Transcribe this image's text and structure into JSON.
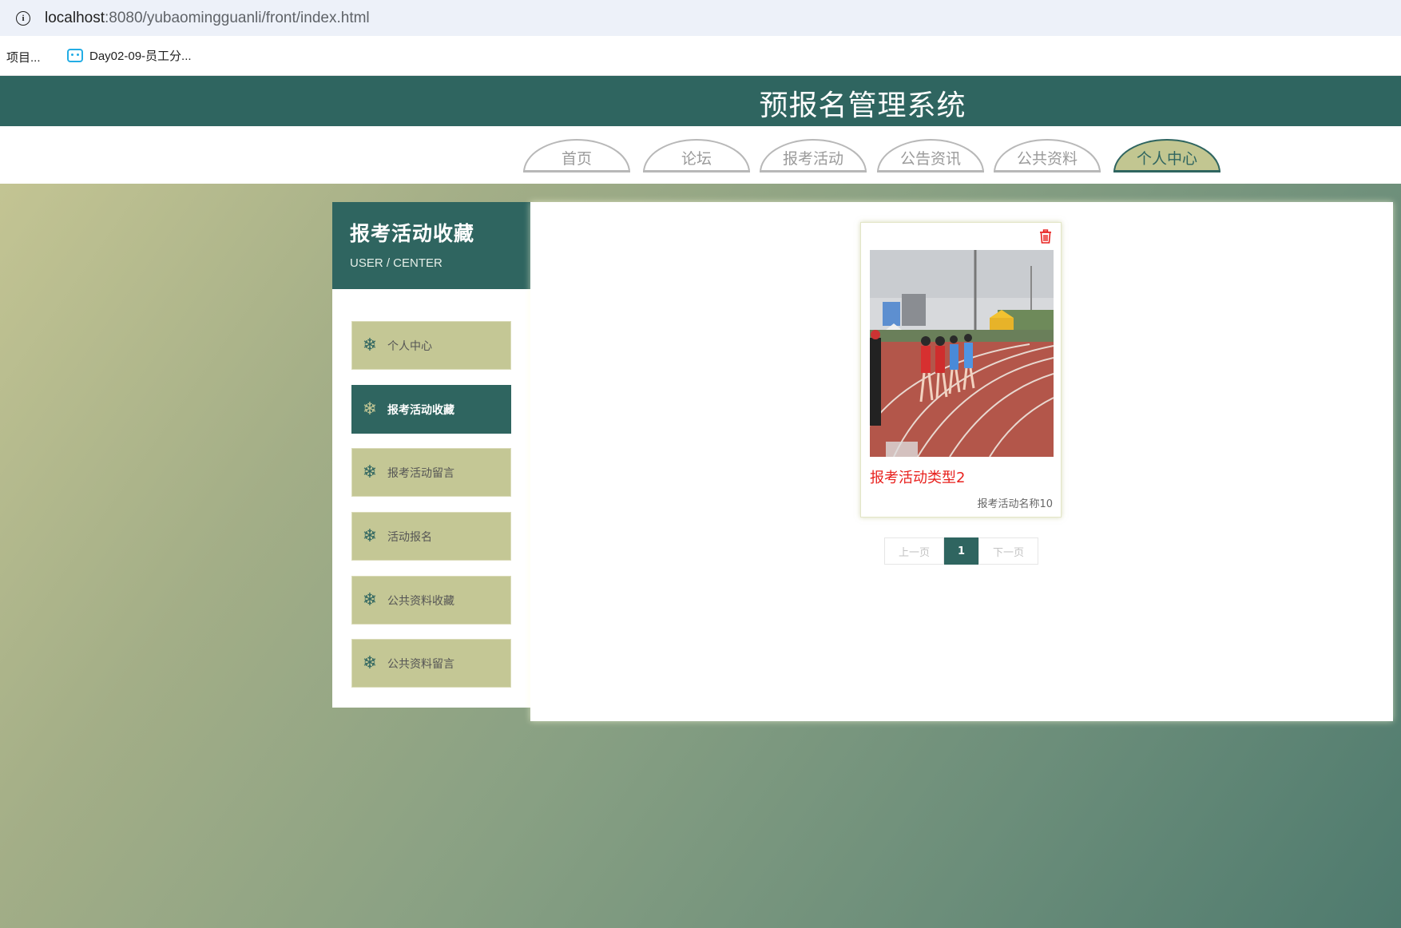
{
  "browser": {
    "url_host": "localhost",
    "url_rest": ":8080/yubaomingguanli/front/index.html",
    "bookmarks": [
      "项目...",
      "Day02-09-员工分..."
    ]
  },
  "site": {
    "title": "预报名管理系统"
  },
  "nav": {
    "tabs": [
      {
        "label": "首页",
        "active": false
      },
      {
        "label": "论坛",
        "active": false
      },
      {
        "label": "报考活动",
        "active": false
      },
      {
        "label": "公告资讯",
        "active": false
      },
      {
        "label": "公共资料",
        "active": false
      },
      {
        "label": "个人中心",
        "active": true
      }
    ]
  },
  "sidebar": {
    "title": "报考活动收藏",
    "subtitle": "USER / CENTER",
    "items": [
      {
        "label": "个人中心",
        "active": false
      },
      {
        "label": "报考活动收藏",
        "active": true
      },
      {
        "label": "报考活动留言",
        "active": false
      },
      {
        "label": "活动报名",
        "active": false
      },
      {
        "label": "公共资料收藏",
        "active": false
      },
      {
        "label": "公共资料留言",
        "active": false
      }
    ]
  },
  "content": {
    "card": {
      "type": "报考活动类型2",
      "name": "报考活动名称10"
    },
    "pager": {
      "prev": "上一页",
      "current": "1",
      "next": "下一页"
    }
  },
  "colors": {
    "primary": "#2f6560",
    "accent": "#c4c795",
    "danger": "#e8211e"
  }
}
